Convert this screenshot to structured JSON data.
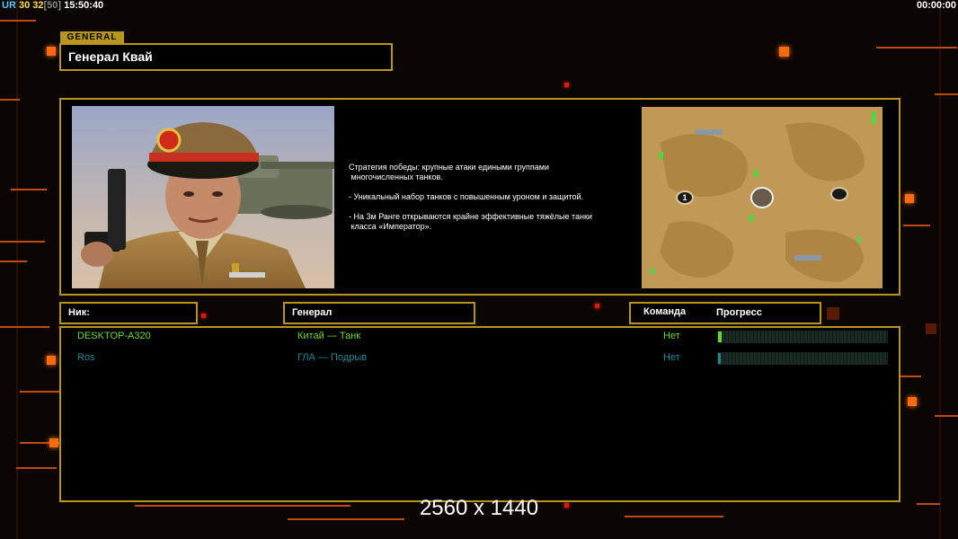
{
  "topbar": {
    "ur_label": "UR",
    "val1": "30",
    "val2": "32",
    "val3": "[50]",
    "clock": "15:50:40",
    "timer": "00:00:00"
  },
  "general": {
    "tag": "GENERAL",
    "name": "Генерал Квай",
    "desc_1": "Стратегия победы: крупные атаки едиными группами",
    "desc_1b": " многочисленных танков.",
    "desc_2": "- Уникальный набор танков с повышенным уроном и защитой.",
    "desc_3": "- На 3м Ранге открываются крайне эффективные тяжёлые танки",
    "desc_3b": " класса «Император»."
  },
  "table": {
    "col_nick": "Ник:",
    "col_general": "Генерал",
    "col_team": "Команда",
    "col_progress": "Прогресс",
    "rows": [
      {
        "nick": "DESKTOP-A320",
        "general": "Китай — Танк",
        "team": "Нет",
        "progress": 0.02,
        "color": "#6ad820"
      },
      {
        "nick": "Ros",
        "general": "ГЛА — Подрыв",
        "team": "Нет",
        "progress": 0.01,
        "color": "#1a8a98"
      }
    ]
  },
  "minimap": {
    "marker_label": "1"
  },
  "footer": {
    "resolution": "2560 x 1440"
  }
}
